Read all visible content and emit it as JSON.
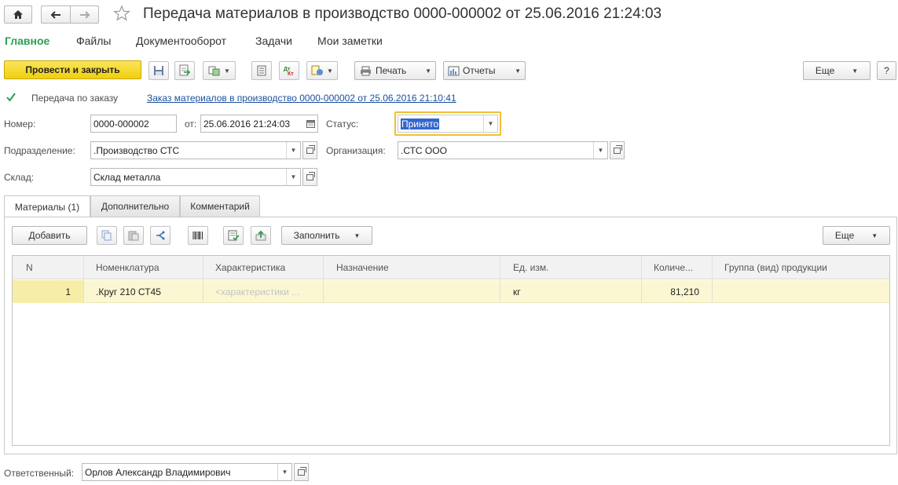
{
  "window": {
    "title": "Передача материалов в производство 0000-000002 от 25.06.2016 21:24:03"
  },
  "menu": {
    "items": [
      "Главное",
      "Файлы",
      "Документооборот",
      "Задачи",
      "Мои заметки"
    ]
  },
  "toolbar": {
    "post_close_label": "Провести и закрыть",
    "print_label": "Печать",
    "reports_label": "Отчеты",
    "more_label": "Еще",
    "help_label": "?"
  },
  "order": {
    "checkbox_label": "Передача по заказу",
    "checked": true,
    "link_text": "Заказ материалов в производство 0000-000002 от 25.06.2016 21:10:41"
  },
  "form": {
    "number_label": "Номер:",
    "number_value": "0000-000002",
    "date_label": "от:",
    "date_value": "25.06.2016 21:24:03",
    "status_label": "Статус:",
    "status_value": "Принято",
    "department_label": "Подразделение:",
    "department_value": ".Производство СТС",
    "organization_label": "Организация:",
    "organization_value": ".СТС ООО",
    "warehouse_label": "Склад:",
    "warehouse_value": "Склад металла",
    "responsible_label": "Ответственный:",
    "responsible_value": "Орлов Александр Владимирович"
  },
  "tabs": [
    {
      "label": "Материалы (1)"
    },
    {
      "label": "Дополнительно"
    },
    {
      "label": "Комментарий"
    }
  ],
  "table_toolbar": {
    "add_label": "Добавить",
    "fill_label": "Заполнить",
    "more_label": "Еще"
  },
  "table": {
    "headers": [
      "N",
      "Номенклатура",
      "Характеристика",
      "Назначение",
      "Ед. изм.",
      "Количе...",
      "Группа (вид) продукции"
    ],
    "rows": [
      [
        "1",
        ".Круг 210 СТ45",
        "<характеристики ...",
        "",
        "кг",
        "81,210",
        ""
      ]
    ]
  },
  "colors": {
    "accent_green": "#2e9e4f",
    "primary_button": "#f5d617",
    "selected_row": "#fbf7d2",
    "link_blue": "#1a4f9e",
    "focus_border": "#f0c030"
  }
}
